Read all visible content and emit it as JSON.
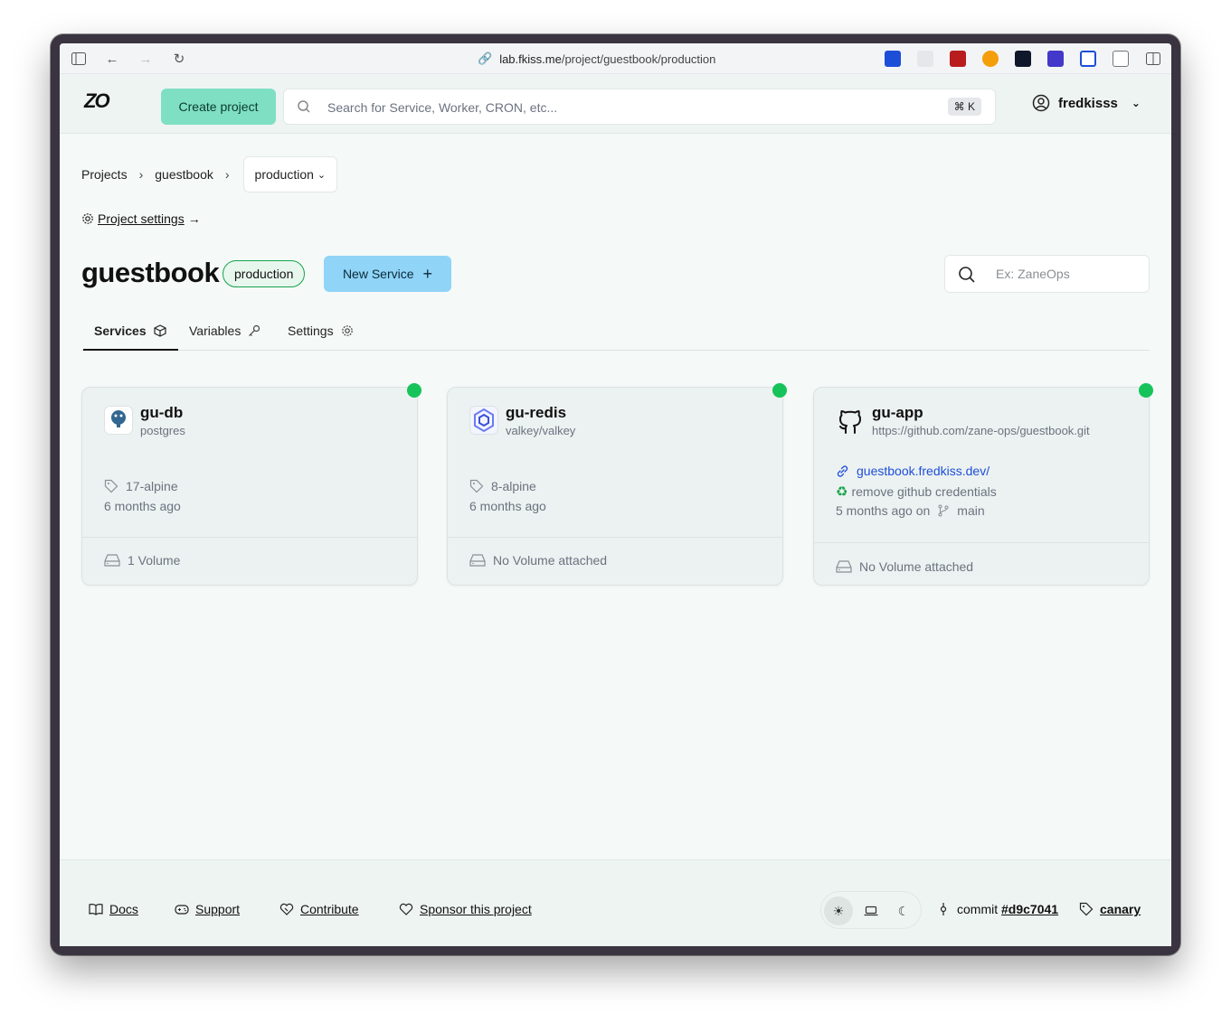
{
  "browser": {
    "url_host": "lab.fkiss.me",
    "url_path": "/project/guestbook/production"
  },
  "header": {
    "logo": "ZO",
    "create_project_label": "Create project",
    "search_placeholder": "Search for Service, Worker, CRON, etc...",
    "search_shortcut": "⌘ K",
    "username": "fredkisss"
  },
  "breadcrumb": {
    "items": [
      "Projects",
      "guestbook"
    ],
    "environment": "production"
  },
  "project_settings_label": "Project settings",
  "project": {
    "title": "guestbook",
    "environment_badge": "production",
    "new_service_label": "New Service",
    "filter_placeholder": "Ex: ZaneOps"
  },
  "tabs": [
    {
      "label": "Services"
    },
    {
      "label": "Variables"
    },
    {
      "label": "Settings"
    }
  ],
  "services": [
    {
      "name": "gu-db",
      "subtitle": "postgres",
      "tag": "17-alpine",
      "updated": "6 months ago",
      "volume": "1 Volume",
      "status_color": "#16c35a"
    },
    {
      "name": "gu-redis",
      "subtitle": "valkey/valkey",
      "tag": "8-alpine",
      "updated": "6 months ago",
      "volume": "No Volume attached",
      "status_color": "#16c35a"
    },
    {
      "name": "gu-app",
      "subtitle": "https://github.com/zane-ops/guestbook.git",
      "url": "guestbook.fredkiss.dev/",
      "commit_message": "remove github credentials",
      "updated": "5 months ago on",
      "branch": "main",
      "volume": "No Volume attached",
      "status_color": "#16c35a"
    }
  ],
  "footer": {
    "docs": "Docs",
    "support": "Support",
    "contribute": "Contribute",
    "sponsor": "Sponsor this project",
    "commit_prefix": "commit",
    "commit_hash": "#d9c7041",
    "channel": "canary"
  }
}
